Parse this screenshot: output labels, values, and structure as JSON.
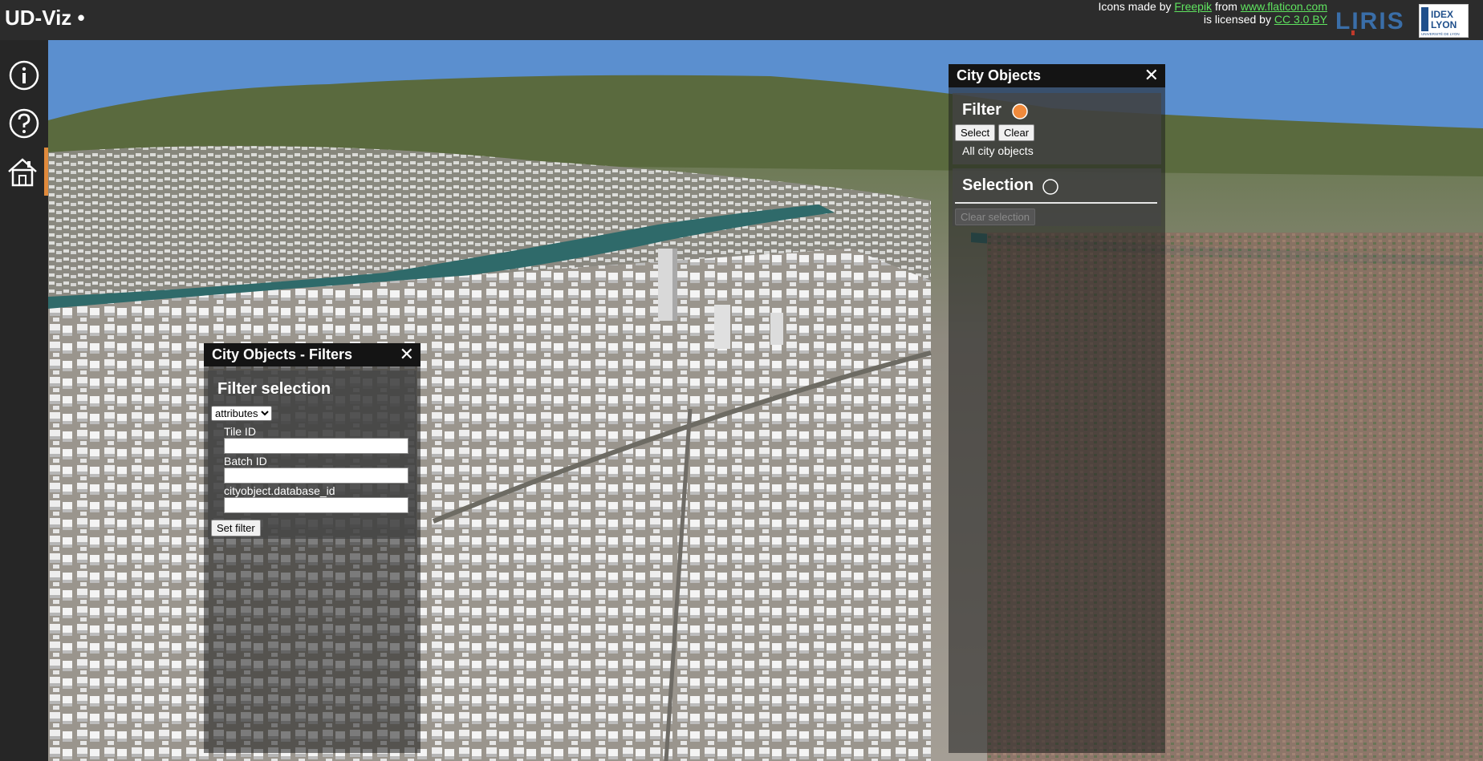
{
  "header": {
    "app_title": "UD-Viz •",
    "credits": {
      "line1_prefix": "Icons made by ",
      "link_freepik": "Freepik",
      "line1_mid": " from ",
      "link_flaticon": "www.flaticon.com",
      "line2_prefix": "is licensed by ",
      "link_license": "CC 3.0 BY"
    },
    "liris_logo_text": "LIRIS",
    "idex_logo_line1": "IDEX",
    "idex_logo_line2": "LYON",
    "idex_logo_line3": "UNIVERSITÉ DE LYON"
  },
  "sidebar": {
    "items": [
      {
        "name": "about",
        "icon": "info-icon"
      },
      {
        "name": "help",
        "icon": "help-icon"
      },
      {
        "name": "city-objects",
        "icon": "home-icon",
        "active": true
      }
    ],
    "active_color": "#e08a3c"
  },
  "filters_panel": {
    "title": "City Objects - Filters",
    "close": "✕",
    "section_title": "Filter selection",
    "select_value": "attributes",
    "fields": [
      {
        "label": "Tile ID",
        "value": ""
      },
      {
        "label": "Batch ID",
        "value": ""
      },
      {
        "label": "cityobject.database_id",
        "value": ""
      }
    ],
    "set_filter_label": "Set filter"
  },
  "city_objects_panel": {
    "title": "City Objects",
    "close": "✕",
    "filter_section": {
      "title": "Filter",
      "indicator_color": "#f08a3c",
      "select_label": "Select",
      "clear_label": "Clear",
      "status": "All city objects"
    },
    "selection_section": {
      "title": "Selection",
      "clear_selection_label": "Clear selection"
    }
  },
  "colors": {
    "sky": "#5b8fcf",
    "header_bg": "#2c2c2c",
    "link": "#5fe35f"
  }
}
